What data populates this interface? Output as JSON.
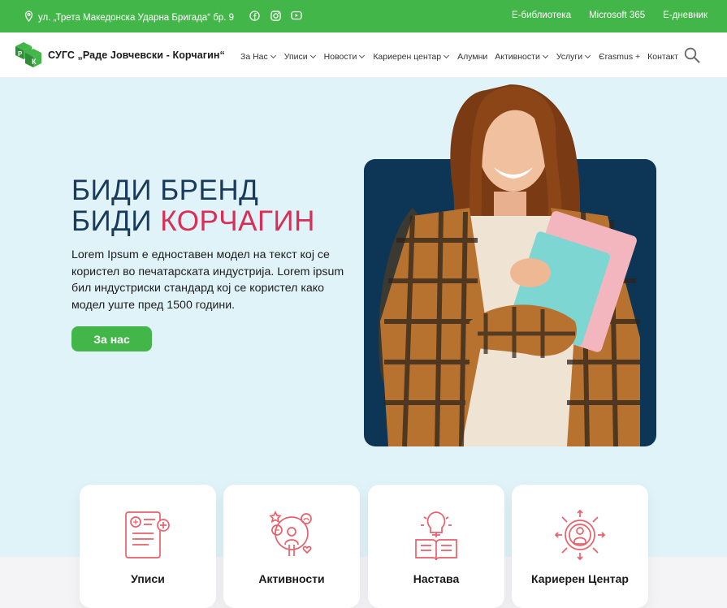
{
  "topbar": {
    "address": "ул. „Трета Македонска Ударна Бригада“ бр. 9",
    "social": [
      "facebook-icon",
      "instagram-icon",
      "youtube-icon"
    ],
    "links": [
      "Е-библиотека",
      "Microsoft 365",
      "Е-дневник"
    ]
  },
  "nav": {
    "brand": "СУГС „Раде Јовчевски - Корчагин“",
    "items": [
      {
        "label": "За Нас",
        "dropdown": true
      },
      {
        "label": "Уписи",
        "dropdown": true
      },
      {
        "label": "Новости",
        "dropdown": true
      },
      {
        "label": "Кариерен центар",
        "dropdown": true
      },
      {
        "label": "Алумни",
        "dropdown": false
      },
      {
        "label": "Активности",
        "dropdown": true
      },
      {
        "label": "Услуги",
        "dropdown": true
      },
      {
        "label": "Єrasmus +",
        "dropdown": false
      },
      {
        "label": "Контакт",
        "dropdown": false
      }
    ]
  },
  "hero": {
    "line1": "БИДИ БРЕНД",
    "line2_prefix": "БИДИ",
    "line2_accent": "КОРЧАГИН",
    "description": "Lorem Ipsum е едноставен модел на текст кој се користел во печатарската индустрија. Lorem ipsum бил индустриски стандард кој се користел како модел уште пред 1500 години.",
    "cta": "За нас"
  },
  "cards": [
    {
      "label": "Уписи",
      "icon": "enrollment-form-icon"
    },
    {
      "label": "Активности",
      "icon": "activities-people-icon"
    },
    {
      "label": "Настава",
      "icon": "book-idea-icon"
    },
    {
      "label": "Кариерен Центар",
      "icon": "career-center-icon"
    }
  ],
  "colors": {
    "green": "#43b649",
    "navy": "#193a5a",
    "accent": "#d92f56",
    "hero_bg": "#dff3f9",
    "photo_bg": "#0d3555",
    "icon": "#e8606b"
  }
}
